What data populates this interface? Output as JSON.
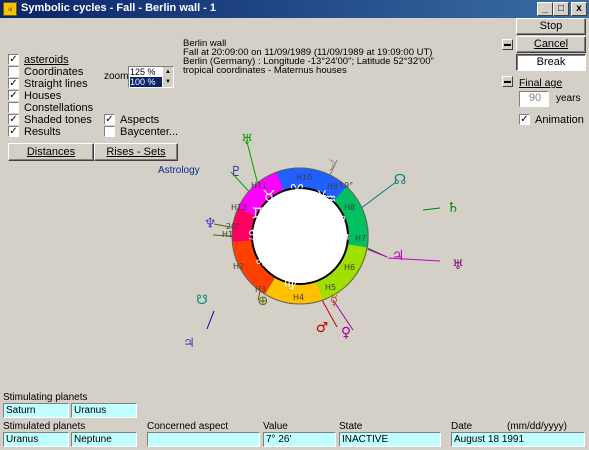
{
  "window": {
    "title": "Symbolic cycles - Fall -   Berlin wall - 1",
    "min": "_",
    "max": "□",
    "close": "x"
  },
  "side_buttons": {
    "stop": "Stop",
    "cancel": "Cancel",
    "break": "Break"
  },
  "final_age": {
    "label": "Final age",
    "value": "90",
    "unit": "years"
  },
  "animation": {
    "label": "Animation",
    "checked": true
  },
  "options": [
    {
      "label": "asteroids",
      "checked": true
    },
    {
      "label": "Coordinates",
      "checked": false
    },
    {
      "label": "Straight lines",
      "checked": true
    },
    {
      "label": "Houses",
      "checked": true
    },
    {
      "label": "Constellations",
      "checked": false
    },
    {
      "label": "Shaded tones",
      "checked": true
    },
    {
      "label": "Results",
      "checked": true
    }
  ],
  "aspects": {
    "label": "Aspects",
    "checked": true
  },
  "baycenter": {
    "label": "Baycenter...",
    "checked": false
  },
  "zoom": {
    "label": "zoom",
    "options": [
      "125 %",
      "100 %"
    ],
    "selected": "100 %"
  },
  "buttons": {
    "distances": "Distances",
    "rises_sets": "Rises - Sets"
  },
  "info": [
    "Berlin wall",
    "Fall at 20:09:00 on 11/09/1989 (11/09/1989 at 19:09:00 UT)",
    "Berlin (Germany) : Longitude -13°24'00\"; Latitude 52°32'00\"",
    "tropical coordinates - Maternus houses"
  ],
  "astrology_label": "Astrology",
  "chart": {
    "houses": [
      "H10",
      "H11",
      "H12",
      "H1",
      "H2",
      "H3",
      "H4",
      "H5",
      "H6",
      "H7",
      "H8",
      "H9"
    ],
    "signs": [
      "♈",
      "♉",
      "♊",
      "♋",
      "♌",
      "♍",
      "♎",
      "♏",
      "♐",
      "♑",
      "♒",
      "♓"
    ],
    "degree_marks": [
      "19°",
      "20°"
    ],
    "planets": [
      "♅",
      "♆",
      "♇",
      "☽",
      "☊",
      "☿",
      "♀",
      "♂",
      "♄",
      "♃"
    ]
  },
  "bottom": {
    "stimulating_label": "Stimulating planets",
    "stimulating": [
      "Saturn",
      "Uranus"
    ],
    "stimulated_label": "Stimulated planets",
    "stimulated": [
      "Uranus",
      "Neptune"
    ],
    "aspect_label": "Concerned aspect",
    "aspect_value": "",
    "value_label": "Value",
    "value": "7° 26'",
    "state_label": "State",
    "state": "INACTIVE",
    "date_label": "Date",
    "date_format": "(mm/dd/yyyy)",
    "date": "August 18 1991"
  }
}
